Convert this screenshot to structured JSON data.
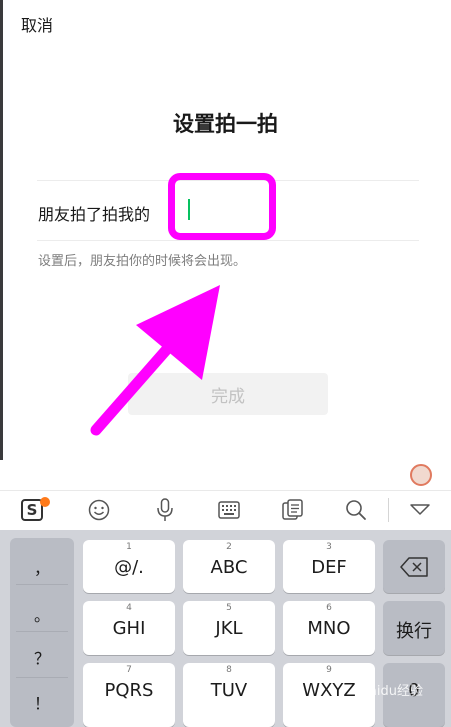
{
  "header": {
    "cancel_label": "取消"
  },
  "title": "设置拍一拍",
  "form": {
    "label": "朋友拍了拍我的",
    "input_value": "",
    "hint": "设置后，朋友拍你的时候将会出现。"
  },
  "done_label": "完成",
  "ime": {
    "toolbar_icons": [
      "sogou-icon",
      "emoji-icon",
      "microphone-icon",
      "keyboard-icon",
      "clipboard-icon",
      "search-icon",
      "collapse-icon"
    ]
  },
  "keyboard": {
    "side_keys": [
      "，",
      "。",
      "？",
      "！"
    ],
    "keys": [
      {
        "num": "1",
        "label": "@/."
      },
      {
        "num": "2",
        "label": "ABC"
      },
      {
        "num": "3",
        "label": "DEF"
      },
      {
        "num": "4",
        "label": "GHI"
      },
      {
        "num": "5",
        "label": "JKL"
      },
      {
        "num": "6",
        "label": "MNO"
      },
      {
        "num": "7",
        "label": "PQRS"
      },
      {
        "num": "8",
        "label": "TUV"
      },
      {
        "num": "9",
        "label": "WXYZ"
      },
      {
        "num": "",
        "label": "0"
      }
    ],
    "enter_label": "换行"
  },
  "watermark": "Baidu经验",
  "colors": {
    "accent": "#07c160",
    "annotation": "#ff00ff"
  }
}
